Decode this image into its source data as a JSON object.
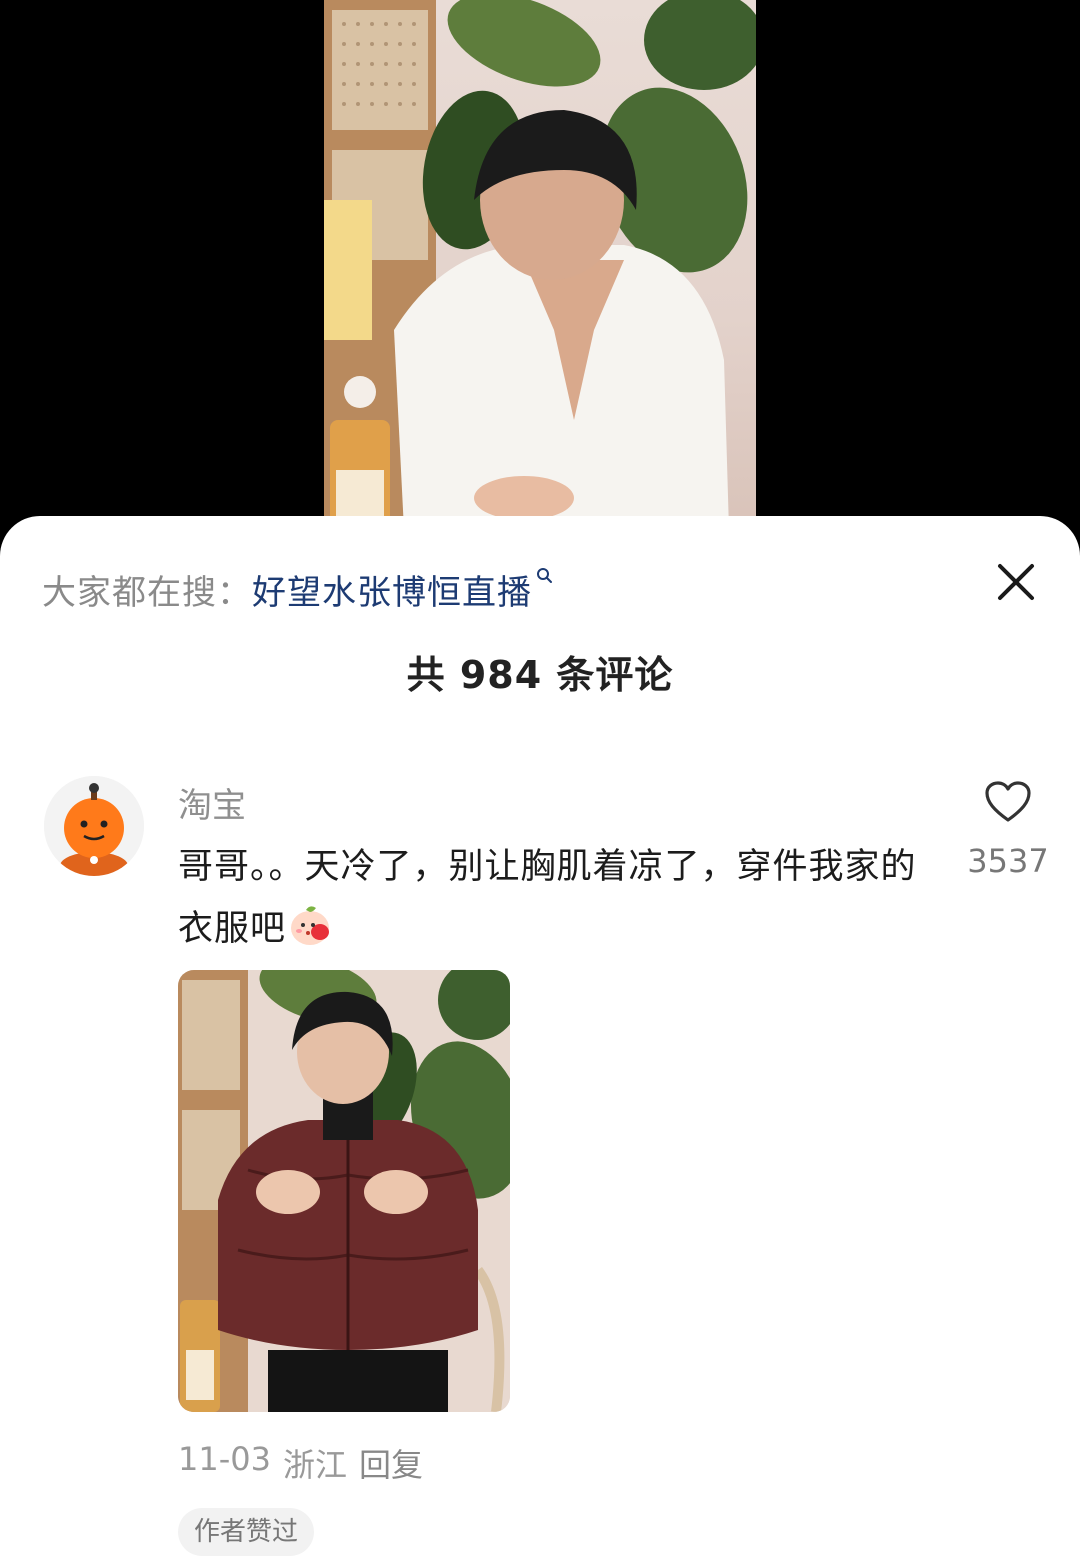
{
  "search_bar": {
    "prefix": "大家都在搜：",
    "query": "好望水张博恒直播"
  },
  "comments_header": {
    "count_text": "共 984 条评论"
  },
  "comment": {
    "author": "淘宝",
    "text": "哥哥。。天冷了，别让胸肌着凉了，穿件我家的衣服吧",
    "emoji_icon": "peach-blush-emoji-icon",
    "like_count": "3537",
    "date": "11-03",
    "location": "浙江",
    "reply_label": "回复",
    "badge": "作者赞过"
  },
  "icons": {
    "close": "close-icon",
    "like": "heart-outline-icon",
    "search": "search-icon"
  },
  "colors": {
    "search_query": "#1d3b73",
    "muted_text": "#8a8a8a",
    "sheet_background": "#ffffff"
  }
}
